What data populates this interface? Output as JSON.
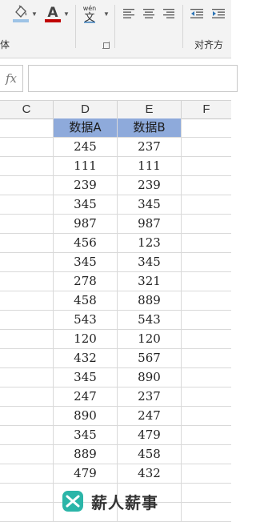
{
  "ribbon": {
    "font_group_label": "体",
    "alignment_group_label": "对齐方",
    "fill_icon": "paint-bucket-icon",
    "font_color_icon": "font-color-icon",
    "phonetic_icon": "phonetic-guide-icon",
    "phonetic_top": "wén",
    "phonetic_bottom": "文",
    "font_color_letter": "A",
    "fill_color": "#9dc3e6",
    "font_color": "#c00000"
  },
  "formula_bar": {
    "fx_label": "fx",
    "value": ""
  },
  "columns": [
    "C",
    "D",
    "E",
    "F"
  ],
  "table": {
    "headers": [
      "数据A",
      "数据B"
    ],
    "rows": [
      [
        "245",
        "237"
      ],
      [
        "111",
        "111"
      ],
      [
        "239",
        "239"
      ],
      [
        "345",
        "345"
      ],
      [
        "987",
        "987"
      ],
      [
        "456",
        "123"
      ],
      [
        "345",
        "345"
      ],
      [
        "278",
        "321"
      ],
      [
        "458",
        "889"
      ],
      [
        "543",
        "543"
      ],
      [
        "120",
        "120"
      ],
      [
        "432",
        "567"
      ],
      [
        "345",
        "890"
      ],
      [
        "247",
        "237"
      ],
      [
        "890",
        "247"
      ],
      [
        "345",
        "479"
      ],
      [
        "889",
        "458"
      ],
      [
        "479",
        "432"
      ]
    ]
  },
  "watermark": {
    "text": "薪人薪事",
    "color": "#2bb5a8"
  }
}
